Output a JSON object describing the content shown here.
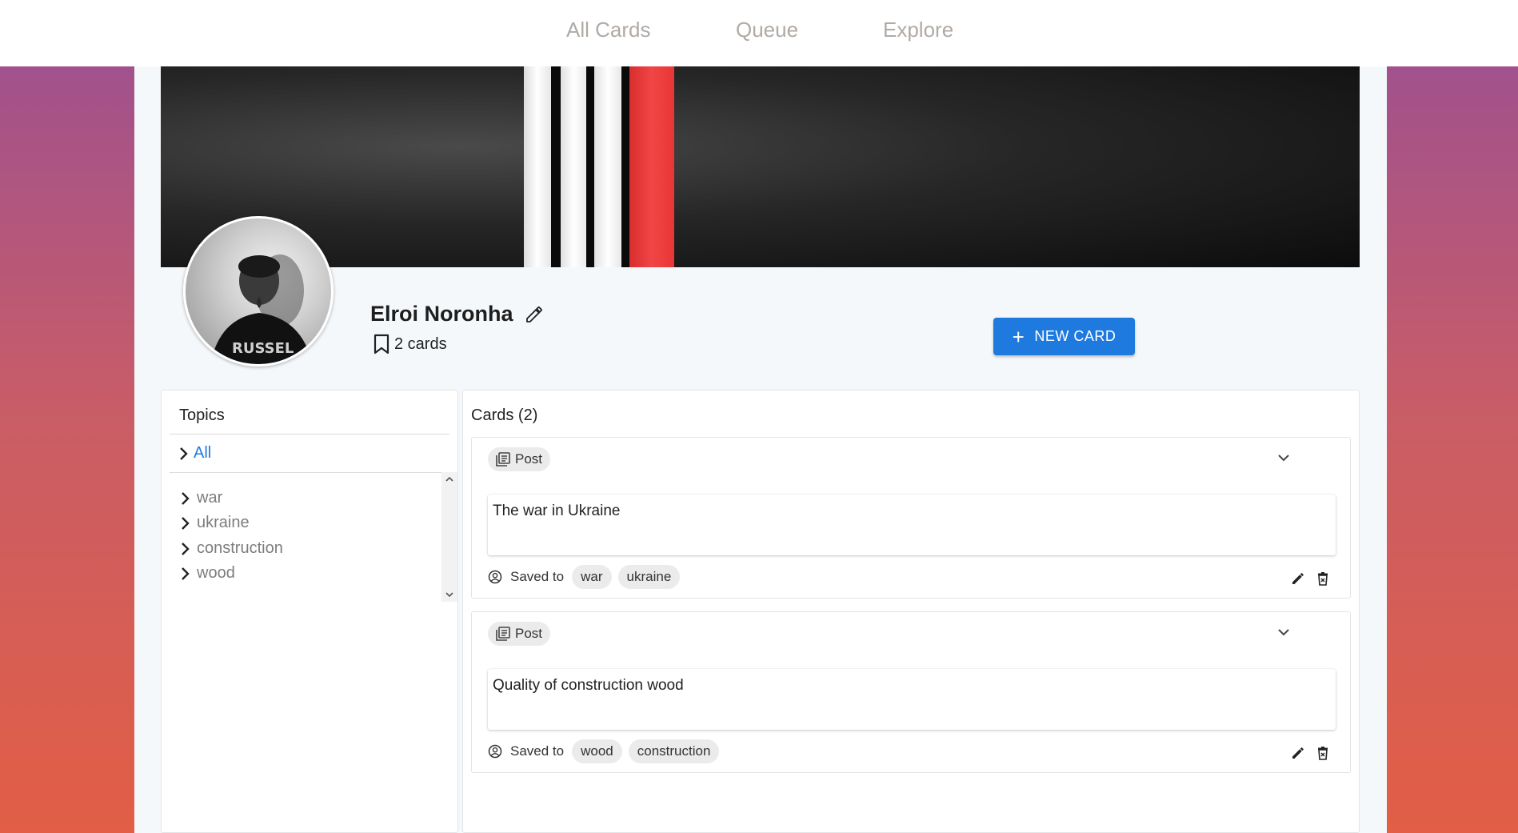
{
  "nav": {
    "all_cards": "All Cards",
    "queue": "Queue",
    "explore": "Explore"
  },
  "profile": {
    "name": "Elroi Noronha",
    "card_count": "2 cards",
    "new_card_label": "NEW CARD"
  },
  "topics": {
    "title": "Topics",
    "all_label": "All",
    "items": [
      {
        "label": "war"
      },
      {
        "label": "ukraine"
      },
      {
        "label": "construction"
      },
      {
        "label": "wood"
      }
    ]
  },
  "cards": {
    "title": "Cards (2)",
    "items": [
      {
        "type": "Post",
        "text": "The war in Ukraine",
        "saved_label": "Saved to",
        "tags": [
          "war",
          "ukraine"
        ]
      },
      {
        "type": "Post",
        "text": "Quality of construction wood",
        "saved_label": "Saved to",
        "tags": [
          "wood",
          "construction"
        ]
      }
    ]
  },
  "colors": {
    "accent": "#1f7ae0",
    "nav_text": "#b0aaa5",
    "banner_red": "#f0403f"
  },
  "icons": [
    "pencil-icon",
    "bookmark-icon",
    "plus-icon",
    "chevron-right-icon",
    "article-icon",
    "chevron-down-icon",
    "account-circle-icon",
    "delete-icon"
  ]
}
